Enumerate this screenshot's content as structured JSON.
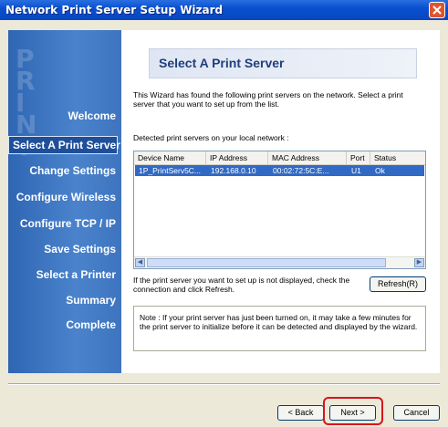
{
  "window": {
    "title": "Network Print Server Setup Wizard"
  },
  "sidebar": {
    "decoration": "PRINT",
    "items": [
      {
        "label": "Welcome"
      },
      {
        "label": "Select A Print Server"
      },
      {
        "label": "Change Settings"
      },
      {
        "label": "Configure Wireless"
      },
      {
        "label": "Configure TCP / IP"
      },
      {
        "label": "Save Settings"
      },
      {
        "label": "Select a Printer"
      },
      {
        "label": "Summary"
      },
      {
        "label": "Complete"
      }
    ],
    "active_index": 1
  },
  "main": {
    "heading": "Select A Print Server",
    "intro": "This Wizard has found the following print servers on the network. Select a print server that you want to set up from the list.",
    "detected_label": "Detected print servers on your local network :",
    "table": {
      "columns": [
        "Device Name",
        "IP Address",
        "MAC Address",
        "Port",
        "Status"
      ],
      "rows": [
        [
          "1P_PrintServ5C...",
          "192.168.0.10",
          "00:02:72:5C:E...",
          "U1",
          "Ok"
        ]
      ]
    },
    "not_displayed_notice": "If the print server you want to set up is not displayed, check the connection and click Refresh.",
    "refresh_label": "Refresh(R)",
    "note": "Note : If your print server has just been turned on, it may take a few minutes for the print server to initialize before it can be detected and displayed by the wizard."
  },
  "footer": {
    "back_label": "< Back",
    "next_label": "Next >",
    "cancel_label": "Cancel"
  },
  "colors": {
    "titlebar": "#0a50d0",
    "sidebar": "#3e74bf",
    "selection": "#316ac5",
    "highlight": "#d8141d"
  }
}
